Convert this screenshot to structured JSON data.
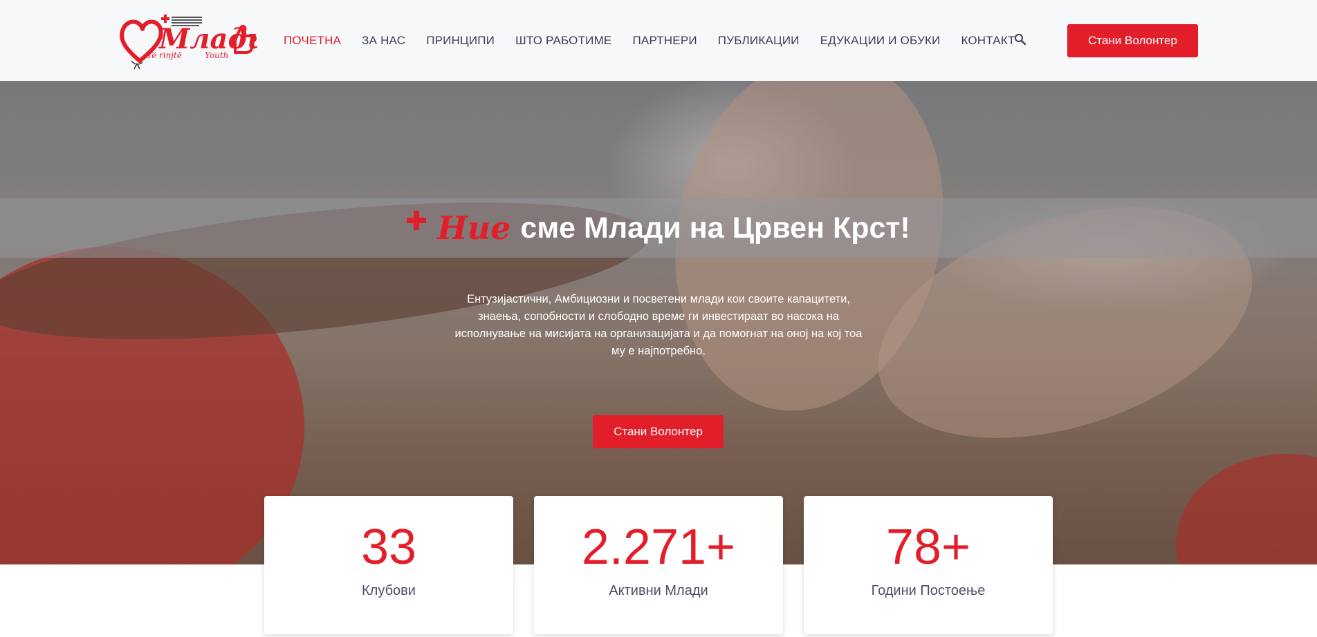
{
  "header": {
    "logo": {
      "script_text": "Млади",
      "sub_text": "Të rinjtë",
      "youth_text": "Youth"
    },
    "nav": [
      {
        "label": "ПОЧЕТНА",
        "active": true
      },
      {
        "label": "ЗА НАС"
      },
      {
        "label": "ПРИНЦИПИ"
      },
      {
        "label": "ШТО РАБОТИМЕ"
      },
      {
        "label": "ПАРТНЕРИ"
      },
      {
        "label": "ПУБЛИКАЦИИ"
      },
      {
        "label": "ЕДУКАЦИИ И ОБУКИ"
      },
      {
        "label": "КОНТАКТ"
      }
    ],
    "search_icon": "search-icon",
    "cta_label": "Стани Волонтер"
  },
  "hero": {
    "title_script": "Ние",
    "title_text": "сме Млади на Црвен Крст!",
    "description": "Ентузијастични, Амбициозни и посветени млади кои своите капацитети, знаења, сопобности и слободно време ги инвестираат во насока на исполнување на мисијата на организацијата и да помогнат на оној на кој тоа му е најпотребно.",
    "cta_label": "Стани Волонтер"
  },
  "stats": [
    {
      "value": "33",
      "label": "Клубови"
    },
    {
      "value": "2.271+",
      "label": "Активни Млади"
    },
    {
      "value": "78+",
      "label": "Години Постоење"
    }
  ],
  "colors": {
    "accent": "#e31e2b",
    "nav_text": "#3a3f55",
    "header_bg": "#f7f8fa"
  }
}
